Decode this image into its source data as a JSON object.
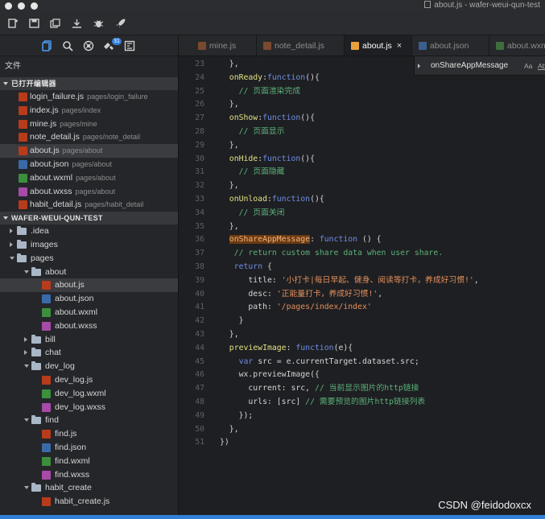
{
  "window": {
    "title": "about.js - wafer-weui-qun-test"
  },
  "toolbar": {
    "icons": [
      "new-file-icon",
      "save-icon",
      "save-all-icon",
      "compile-icon",
      "debug-icon",
      "rocket-icon"
    ]
  },
  "sidebar": {
    "icons": [
      "files-icon",
      "search-icon",
      "git-icon",
      "extensions-icon",
      "outline-icon"
    ],
    "extensions_badge": "31",
    "files_label": "文件",
    "open_editors_label": "已打开编辑器",
    "open_editors": [
      {
        "name": "login_failure.js",
        "path": "pages/login_failure",
        "type": "js"
      },
      {
        "name": "index.js",
        "path": "pages/index",
        "type": "js"
      },
      {
        "name": "mine.js",
        "path": "pages/mine",
        "type": "js"
      },
      {
        "name": "note_detail.js",
        "path": "pages/note_detail",
        "type": "js"
      },
      {
        "name": "about.js",
        "path": "pages/about",
        "type": "js",
        "selected": true
      },
      {
        "name": "about.json",
        "path": "pages/about",
        "type": "json"
      },
      {
        "name": "about.wxml",
        "path": "pages/about",
        "type": "wxml"
      },
      {
        "name": "about.wxss",
        "path": "pages/about",
        "type": "wxss"
      },
      {
        "name": "habit_detail.js",
        "path": "pages/habit_detail",
        "type": "js"
      }
    ],
    "project_label": "WAFER-WEUI-QUN-TEST",
    "tree": [
      {
        "kind": "folder",
        "name": ".idea",
        "depth": 0,
        "open": false
      },
      {
        "kind": "folder",
        "name": "images",
        "depth": 0,
        "open": false
      },
      {
        "kind": "folder",
        "name": "pages",
        "depth": 0,
        "open": true
      },
      {
        "kind": "folder",
        "name": "about",
        "depth": 1,
        "open": true
      },
      {
        "kind": "file",
        "name": "about.js",
        "depth": 2,
        "type": "js",
        "selected": true
      },
      {
        "kind": "file",
        "name": "about.json",
        "depth": 2,
        "type": "json"
      },
      {
        "kind": "file",
        "name": "about.wxml",
        "depth": 2,
        "type": "wxml"
      },
      {
        "kind": "file",
        "name": "about.wxss",
        "depth": 2,
        "type": "wxss"
      },
      {
        "kind": "folder",
        "name": "bill",
        "depth": 1,
        "open": false
      },
      {
        "kind": "folder",
        "name": "chat",
        "depth": 1,
        "open": false
      },
      {
        "kind": "folder",
        "name": "dev_log",
        "depth": 1,
        "open": true
      },
      {
        "kind": "file",
        "name": "dev_log.js",
        "depth": 2,
        "type": "js"
      },
      {
        "kind": "file",
        "name": "dev_log.wxml",
        "depth": 2,
        "type": "wxml"
      },
      {
        "kind": "file",
        "name": "dev_log.wxss",
        "depth": 2,
        "type": "wxss"
      },
      {
        "kind": "folder",
        "name": "find",
        "depth": 1,
        "open": true
      },
      {
        "kind": "file",
        "name": "find.js",
        "depth": 2,
        "type": "js"
      },
      {
        "kind": "file",
        "name": "find.json",
        "depth": 2,
        "type": "json"
      },
      {
        "kind": "file",
        "name": "find.wxml",
        "depth": 2,
        "type": "wxml"
      },
      {
        "kind": "file",
        "name": "find.wxss",
        "depth": 2,
        "type": "wxss"
      },
      {
        "kind": "folder",
        "name": "habit_create",
        "depth": 1,
        "open": true
      },
      {
        "kind": "file",
        "name": "habit_create.js",
        "depth": 2,
        "type": "js"
      }
    ]
  },
  "tabs": [
    {
      "label": "mine.js",
      "type": "js",
      "active": false
    },
    {
      "label": "note_detail.js",
      "type": "js",
      "active": false
    },
    {
      "label": "about.js",
      "type": "js",
      "active": true
    },
    {
      "label": "about.json",
      "type": "json",
      "active": false
    },
    {
      "label": "about.wxml",
      "type": "wxml",
      "active": false
    }
  ],
  "tab_close": "×",
  "find": {
    "query": "onShareAppMessage",
    "match_case": "Aa",
    "whole_word": "Ab"
  },
  "editor": {
    "lines": [
      {
        "n": "23",
        "tokens": [
          [
            "def",
            "  },"
          ]
        ]
      },
      {
        "n": "24",
        "tokens": [
          [
            "prop",
            "  onReady"
          ],
          [
            "def",
            ":"
          ],
          [
            "kw",
            "function"
          ],
          [
            "def",
            "(){"
          ]
        ]
      },
      {
        "n": "25",
        "tokens": [
          [
            "cmt",
            "    // 页面渲染完成"
          ]
        ]
      },
      {
        "n": "26",
        "tokens": [
          [
            "def",
            "  },"
          ]
        ]
      },
      {
        "n": "27",
        "tokens": [
          [
            "prop",
            "  onShow"
          ],
          [
            "def",
            ":"
          ],
          [
            "kw",
            "function"
          ],
          [
            "def",
            "(){"
          ]
        ]
      },
      {
        "n": "28",
        "tokens": [
          [
            "cmt",
            "    // 页面显示"
          ]
        ]
      },
      {
        "n": "29",
        "tokens": [
          [
            "def",
            "  },"
          ]
        ]
      },
      {
        "n": "30",
        "tokens": [
          [
            "prop",
            "  onHide"
          ],
          [
            "def",
            ":"
          ],
          [
            "kw",
            "function"
          ],
          [
            "def",
            "(){"
          ]
        ]
      },
      {
        "n": "31",
        "tokens": [
          [
            "cmt",
            "    // 页面隐藏"
          ]
        ]
      },
      {
        "n": "32",
        "tokens": [
          [
            "def",
            "  },"
          ]
        ]
      },
      {
        "n": "33",
        "tokens": [
          [
            "prop",
            "  onUnload"
          ],
          [
            "def",
            ":"
          ],
          [
            "kw",
            "function"
          ],
          [
            "def",
            "(){"
          ]
        ]
      },
      {
        "n": "34",
        "tokens": [
          [
            "cmt",
            "    // 页面关闭"
          ]
        ]
      },
      {
        "n": "35",
        "tokens": [
          [
            "def",
            "  },"
          ]
        ]
      },
      {
        "n": "36",
        "tokens": [
          [
            "def",
            "  "
          ],
          [
            "hl",
            "onShareAppMessage"
          ],
          [
            "def",
            ": "
          ],
          [
            "kw",
            "function"
          ],
          [
            "def",
            " () {"
          ]
        ]
      },
      {
        "n": "37",
        "tokens": [
          [
            "cmt",
            "   // return custom share data when user share."
          ]
        ]
      },
      {
        "n": "38",
        "tokens": [
          [
            "def",
            "   "
          ],
          [
            "kw",
            "return"
          ],
          [
            "def",
            " {"
          ]
        ]
      },
      {
        "n": "39",
        "tokens": [
          [
            "def",
            "      title: "
          ],
          [
            "str",
            "'小打卡|每日早起、健身、阅读等打卡，养成好习惯!'"
          ],
          [
            "def",
            ","
          ]
        ]
      },
      {
        "n": "40",
        "tokens": [
          [
            "def",
            "      desc: "
          ],
          [
            "str",
            "'正能量打卡，养成好习惯!'"
          ],
          [
            "def",
            ","
          ]
        ]
      },
      {
        "n": "41",
        "tokens": [
          [
            "def",
            "      path: "
          ],
          [
            "str",
            "'/pages/index/index'"
          ]
        ]
      },
      {
        "n": "42",
        "tokens": [
          [
            "def",
            "    }"
          ]
        ]
      },
      {
        "n": "43",
        "tokens": [
          [
            "def",
            "  },"
          ]
        ]
      },
      {
        "n": "44",
        "tokens": [
          [
            "prop",
            "  previewImage"
          ],
          [
            "def",
            ": "
          ],
          [
            "kw",
            "function"
          ],
          [
            "def",
            "(e){"
          ]
        ]
      },
      {
        "n": "45",
        "tokens": [
          [
            "def",
            "    "
          ],
          [
            "kw",
            "var"
          ],
          [
            "def",
            " src = e.currentTarget.dataset.src;"
          ]
        ]
      },
      {
        "n": "46",
        "tokens": [
          [
            "def",
            "    wx.previewImage({"
          ]
        ]
      },
      {
        "n": "47",
        "tokens": [
          [
            "def",
            "      current: src, "
          ],
          [
            "cmt",
            "// 当前显示图片的http链接"
          ]
        ]
      },
      {
        "n": "48",
        "tokens": [
          [
            "def",
            "      urls: [src] "
          ],
          [
            "cmt",
            "// 需要预览的图片http链接列表"
          ]
        ]
      },
      {
        "n": "49",
        "tokens": [
          [
            "def",
            "    });"
          ]
        ]
      },
      {
        "n": "50",
        "tokens": [
          [
            "def",
            "  },"
          ]
        ]
      },
      {
        "n": "51",
        "tokens": [
          [
            "def",
            "})"
          ]
        ]
      }
    ]
  },
  "watermark": "CSDN @feidodoxcx"
}
